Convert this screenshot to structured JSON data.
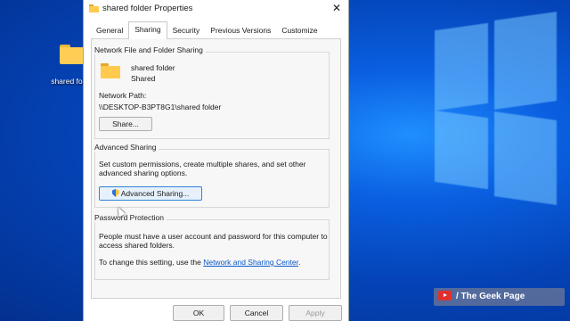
{
  "desktop": {
    "icon_label": "shared folder"
  },
  "dialog": {
    "title": "shared folder Properties",
    "tabs": [
      {
        "label": "General"
      },
      {
        "label": "Sharing",
        "active": true
      },
      {
        "label": "Security"
      },
      {
        "label": "Previous Versions"
      },
      {
        "label": "Customize"
      }
    ],
    "network_sharing": {
      "heading": "Network File and Folder Sharing",
      "folder_name": "shared folder",
      "folder_status": "Shared",
      "path_label": "Network Path:",
      "path_value": "\\\\DESKTOP-B3PT8G1\\shared folder",
      "share_button": "Share..."
    },
    "advanced_sharing": {
      "heading": "Advanced Sharing",
      "description_line1": "Set custom permissions, create multiple shares, and set other",
      "description_line2": "advanced sharing options.",
      "button": "Advanced Sharing..."
    },
    "password_protection": {
      "heading": "Password Protection",
      "description_line1": "People must have a user account and password for this computer to",
      "description_line2": "access shared folders.",
      "change_text": "To change this setting, use the",
      "link_text": "Network and Sharing Center",
      "link_suffix": "."
    },
    "footer": {
      "ok": "OK",
      "cancel": "Cancel",
      "apply": "Apply"
    }
  },
  "watermark": {
    "text": "/ The Geek Page"
  },
  "colors": {
    "desktop_blue": "#0a5fe0",
    "link": "#0a58ca",
    "folder": "#ffca4e"
  }
}
